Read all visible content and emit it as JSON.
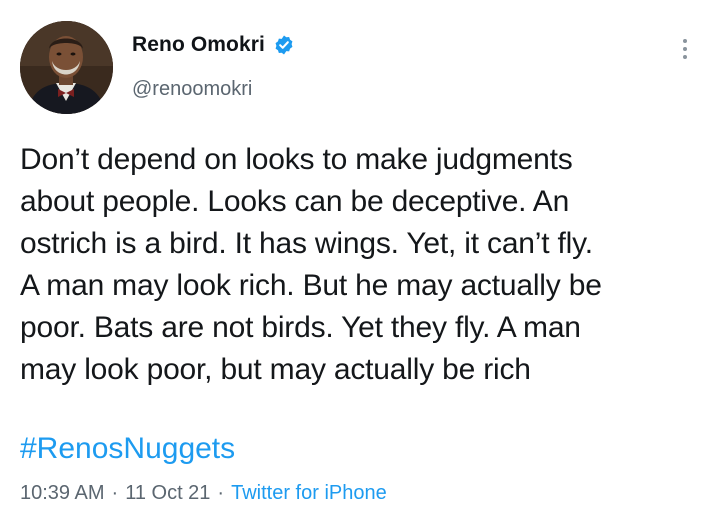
{
  "author": {
    "display_name": "Reno Omokri",
    "handle": "@renoomokri",
    "verified": true
  },
  "tweet": {
    "lines": [
      "Don’t depend on looks to make judgments",
      "about people. Looks can be deceptive. An",
      "ostrich is a bird. It has wings. Yet, it can’t fly.",
      "A man may look rich. But he may actually be",
      "poor. Bats are not birds. Yet they fly. A man",
      "may look poor, but may actually be rich"
    ],
    "hashtag": "#RenosNuggets"
  },
  "meta": {
    "time": "10:39 AM",
    "separator": "·",
    "date": "11 Oct 21",
    "source": "Twitter for iPhone"
  },
  "colors": {
    "accent": "#1d9bf0",
    "secondary_text": "#5b6670",
    "primary_text": "#14171a"
  },
  "icons": {
    "verified": "verified-badge-icon",
    "more": "more-options-icon"
  }
}
